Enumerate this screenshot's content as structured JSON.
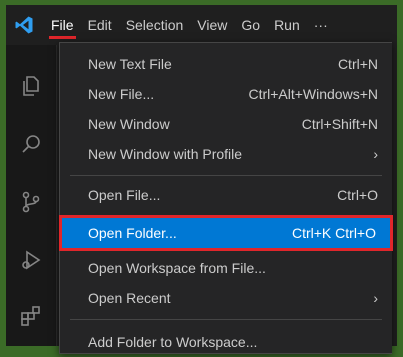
{
  "titlebar": {
    "menu": [
      "File",
      "Edit",
      "Selection",
      "View",
      "Go",
      "Run",
      "···"
    ]
  },
  "activity_icons": [
    "files-icon",
    "search-icon",
    "source-control-icon",
    "run-debug-icon",
    "extensions-icon"
  ],
  "file_menu": {
    "items": [
      {
        "label": "New Text File",
        "keys": "Ctrl+N"
      },
      {
        "label": "New File...",
        "keys": "Ctrl+Alt+Windows+N"
      },
      {
        "label": "New Window",
        "keys": "Ctrl+Shift+N"
      },
      {
        "label": "New Window with Profile",
        "submenu": "›"
      },
      {
        "label": "Open File...",
        "keys": "Ctrl+O"
      },
      {
        "label": "Open Folder...",
        "keys": "Ctrl+K Ctrl+O",
        "selected": true
      },
      {
        "label": "Open Workspace from File..."
      },
      {
        "label": "Open Recent",
        "submenu": "›"
      },
      {
        "label": "Add Folder to Workspace..."
      }
    ]
  },
  "colors": {
    "highlight": "#0078d4",
    "annotation": "#e0262b",
    "border": "#3b6b27"
  }
}
